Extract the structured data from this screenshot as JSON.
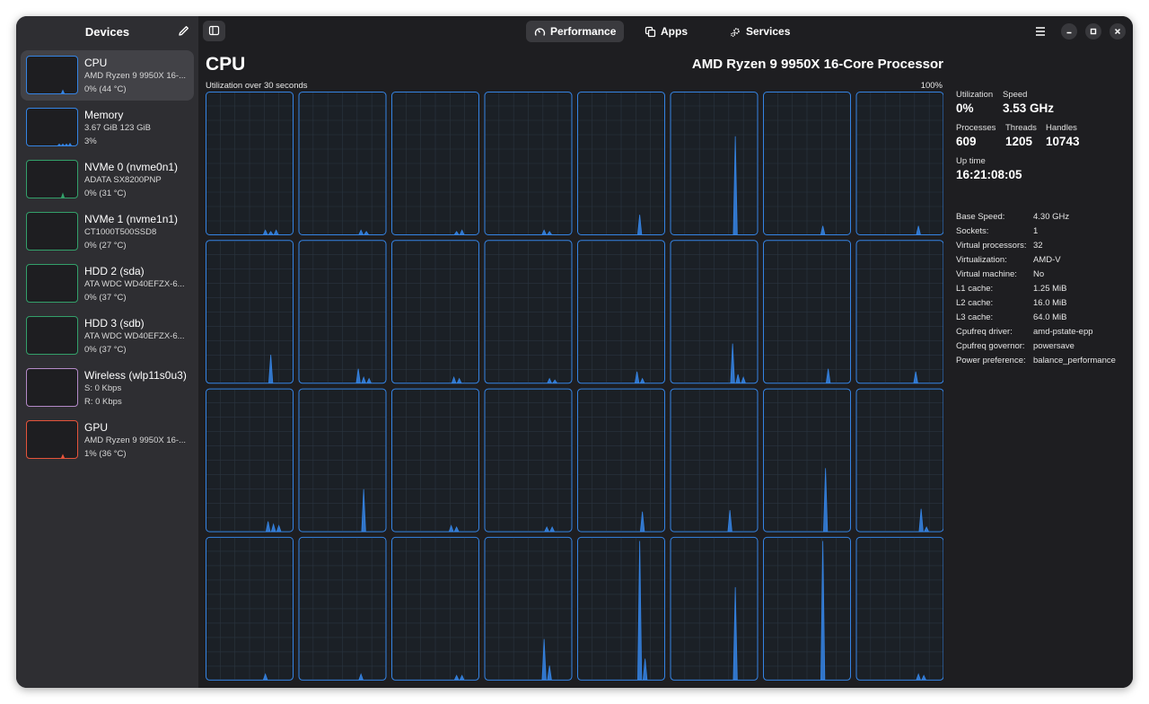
{
  "sidebar": {
    "title": "Devices",
    "edit_icon": "pencil-icon",
    "devices": [
      {
        "name": "CPU",
        "sub1": "AMD Ryzen 9 9950X 16-...",
        "sub2": "0% (44 °C)",
        "color": "#3584e4",
        "spikes": [
          0.12
        ],
        "selected": true
      },
      {
        "name": "Memory",
        "sub1": "3.67 GiB 123 GiB",
        "sub2": "3%",
        "color": "#3584e4",
        "spikes": [
          0.06,
          0.06,
          0.06,
          0.08
        ],
        "selected": false
      },
      {
        "name": "NVMe 0 (nvme0n1)",
        "sub1": "ADATA SX8200PNP",
        "sub2": "0% (31 °C)",
        "color": "#33a06a",
        "spikes": [
          0.15
        ],
        "selected": false
      },
      {
        "name": "NVMe 1 (nvme1n1)",
        "sub1": "CT1000T500SSD8",
        "sub2": "0% (27 °C)",
        "color": "#33a06a",
        "spikes": [],
        "selected": false
      },
      {
        "name": "HDD 2 (sda)",
        "sub1": "ATA WDC WD40EFZX-6...",
        "sub2": "0% (37 °C)",
        "color": "#33a06a",
        "spikes": [],
        "selected": false
      },
      {
        "name": "HDD 3 (sdb)",
        "sub1": "ATA WDC WD40EFZX-6...",
        "sub2": "0% (37 °C)",
        "color": "#33a06a",
        "spikes": [],
        "selected": false
      },
      {
        "name": "Wireless (wlp11s0u3)",
        "sub1": "S: 0 Kbps",
        "sub2": "R: 0 Kbps",
        "color": "#b48ac8",
        "spikes": [],
        "selected": false
      },
      {
        "name": "GPU",
        "sub1": "AMD Ryzen 9 9950X 16-...",
        "sub2": "1% (36 °C)",
        "color": "#e5543b",
        "spikes": [
          0.12
        ],
        "selected": false
      }
    ]
  },
  "topbar": {
    "sidebar_toggle_icon": "sidebar-toggle-icon",
    "tabs": [
      {
        "label": "Performance",
        "icon": "gauge-icon",
        "active": true
      },
      {
        "label": "Apps",
        "icon": "apps-icon",
        "active": false
      },
      {
        "label": "Services",
        "icon": "gear-icon",
        "active": false
      }
    ],
    "menu_icon": "hamburger-menu-icon"
  },
  "page": {
    "title": "CPU",
    "processor": "AMD Ryzen 9 9950X 16-Core Processor",
    "graph_label": "Utilization over 30 seconds",
    "graph_max": "100%",
    "graph_color": "#3584e4"
  },
  "core_spikes": [
    [
      0.03,
      0.02,
      0.03
    ],
    [
      0.03,
      0.02
    ],
    [
      0.02,
      0.03
    ],
    [
      0.03,
      0.02
    ],
    [
      0.14
    ],
    [
      0.7
    ],
    [
      0.06
    ],
    [
      0.06
    ],
    [
      0.2
    ],
    [
      0.1,
      0.04,
      0.03
    ],
    [
      0.04,
      0.03
    ],
    [
      0.03,
      0.02
    ],
    [
      0.08,
      0.03
    ],
    [
      0.28,
      0.06,
      0.04
    ],
    [
      0.1
    ],
    [
      0.08
    ],
    [
      0.07,
      0.05,
      0.04
    ],
    [
      0.3
    ],
    [
      0.04,
      0.03
    ],
    [
      0.03,
      0.03
    ],
    [
      0.14
    ],
    [
      0.15
    ],
    [
      0.45
    ],
    [
      0.16,
      0.03
    ],
    [
      0.04
    ],
    [
      0.04
    ],
    [
      0.03,
      0.03
    ],
    [
      0.29,
      0.1
    ],
    [
      0.99,
      0.15
    ],
    [
      0.66
    ],
    [
      0.99
    ],
    [
      0.04,
      0.03
    ]
  ],
  "stats": {
    "utilization_label": "Utilization",
    "utilization": "0%",
    "speed_label": "Speed",
    "speed": "3.53 GHz",
    "processes_label": "Processes",
    "processes": "609",
    "threads_label": "Threads",
    "threads": "1205",
    "handles_label": "Handles",
    "handles": "10743",
    "uptime_label": "Up time",
    "uptime": "16:21:08:05",
    "details": [
      {
        "k": "Base Speed:",
        "v": "4.30 GHz"
      },
      {
        "k": "Sockets:",
        "v": "1"
      },
      {
        "k": "Virtual processors:",
        "v": "32"
      },
      {
        "k": "Virtualization:",
        "v": "AMD-V"
      },
      {
        "k": "Virtual machine:",
        "v": "No"
      },
      {
        "k": "L1 cache:",
        "v": "1.25 MiB"
      },
      {
        "k": "L2 cache:",
        "v": "16.0 MiB"
      },
      {
        "k": "L3 cache:",
        "v": "64.0 MiB"
      },
      {
        "k": "Cpufreq driver:",
        "v": "amd-pstate-epp"
      },
      {
        "k": "Cpufreq governor:",
        "v": "powersave"
      },
      {
        "k": "Power preference:",
        "v": "balance_performance"
      }
    ]
  }
}
